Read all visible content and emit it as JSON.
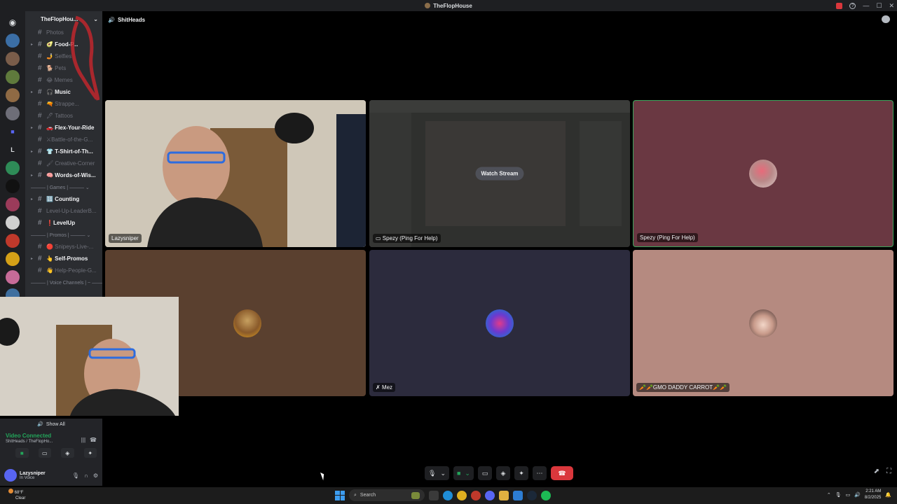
{
  "window": {
    "title": "TheFlopHouse"
  },
  "colors": {
    "accent": "#5865f2",
    "connected": "#23a55a",
    "danger": "#da373c",
    "speaking_border": "#3ba55c"
  },
  "server": {
    "name": "TheFlopHou..."
  },
  "channels": [
    {
      "prefix": "#",
      "label": "Photos",
      "style": "muted",
      "arrow": false
    },
    {
      "prefix": "#",
      "label": "🥑 Food-P...",
      "style": "bold",
      "arrow": true
    },
    {
      "prefix": "#",
      "label": "🤳 Selfies",
      "style": "muted",
      "arrow": false
    },
    {
      "prefix": "#",
      "label": "🐕 Pets",
      "style": "muted",
      "arrow": false
    },
    {
      "prefix": "#",
      "label": "😂 Memes",
      "style": "muted",
      "arrow": false
    },
    {
      "prefix": "#",
      "label": "🎧 Music",
      "style": "bold",
      "arrow": true
    },
    {
      "prefix": "#",
      "label": "🔫 Strappe...",
      "style": "muted",
      "arrow": false
    },
    {
      "prefix": "#",
      "label": "🖋 Tattoos",
      "style": "muted",
      "arrow": false
    },
    {
      "prefix": "#",
      "label": "🚗 Flex-Your-Ride",
      "style": "bold",
      "arrow": true
    },
    {
      "prefix": "#",
      "label": "⚔Battle-of-the-G...",
      "style": "muted",
      "arrow": false
    },
    {
      "prefix": "#",
      "label": "👕 T-Shirt-of-Th...",
      "style": "bold",
      "arrow": true
    },
    {
      "prefix": "#",
      "label": "🖌 Creative-Corner",
      "style": "muted",
      "arrow": false
    },
    {
      "prefix": "#",
      "label": "🧠 Words-of-Wis...",
      "style": "bold",
      "arrow": true
    }
  ],
  "category_games": "——— | Games | ——— ⌄",
  "channels_games": [
    {
      "prefix": "#",
      "label": "🔢 Counting",
      "style": "bold",
      "arrow": true
    },
    {
      "prefix": "#",
      "label": "Level-Up-LeaderB...",
      "style": "muted",
      "arrow": false
    },
    {
      "prefix": "#",
      "label": "❗LevelUp",
      "style": "bold",
      "arrow": false
    }
  ],
  "category_promos": "——— | Promos | ——— ⌄",
  "channels_promos": [
    {
      "prefix": "#",
      "label": "🔴 Snipeys-Live-...",
      "style": "muted",
      "arrow": false
    },
    {
      "prefix": "#",
      "label": "👆 Self-Promos",
      "style": "bold",
      "arrow": true
    },
    {
      "prefix": "#",
      "label": "👋 Help-People-G...",
      "style": "muted",
      "arrow": false
    }
  ],
  "category_voice": "——— | Voice Channels | ~ ——— ⌄",
  "voice_channel": {
    "name": "ShitHeads"
  },
  "tiles": [
    {
      "name": "Lazysniper"
    },
    {
      "name": "Spezy (Ping For Help)",
      "overlay": "Watch Stream"
    },
    {
      "name": "Spezy (Ping For Help)"
    },
    {
      "name": ""
    },
    {
      "name": "Mez"
    },
    {
      "name": "🥕🥕GMO DADDY CARROT🥕🥕"
    }
  ],
  "show_all": "Show All",
  "voice_status": {
    "status": "Video Connected",
    "location": "ShitHeads / TheFlopHo..."
  },
  "user": {
    "name": "Lazysniper",
    "status": "In Voice"
  },
  "taskbar": {
    "weather_temp": "68°F",
    "weather_cond": "Clear",
    "search_placeholder": "Search",
    "time": "2:21 AM",
    "date": "8/2/2025"
  }
}
